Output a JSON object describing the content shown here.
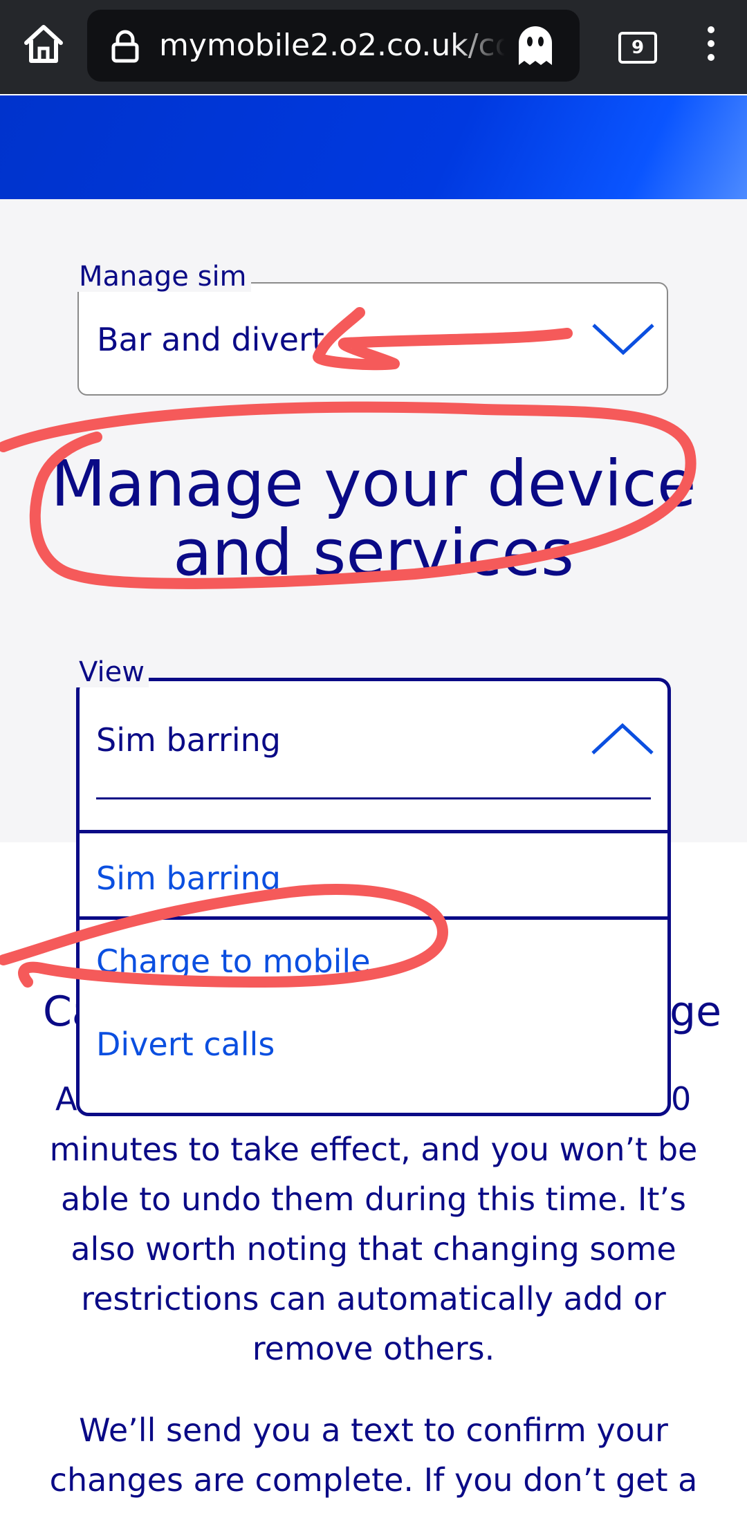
{
  "browser": {
    "url": "mymobile2.o2.co.uk/co",
    "tab_count": "9"
  },
  "manage_sim": {
    "label": "Manage sim",
    "value": "Bar and divert"
  },
  "heading": "Manage your device and services",
  "view": {
    "label": "View",
    "value": "Sim barring",
    "options": [
      "Sim barring",
      "Charge to mobile",
      "Divert calls"
    ]
  },
  "content": {
    "heading_start": "Ca",
    "heading_end": "ge",
    "paragraph1_start": "A",
    "paragraph1_end": "0",
    "paragraph1_rest": "minutes to take effect, and you won’t be able to undo them during this time. It’s also worth noting that changing some restrictions can automatically add or remove others.",
    "paragraph2": "We’ll send you a text to confirm your changes are complete. If you don’t get a"
  },
  "annotation_color": "#f55a5a"
}
